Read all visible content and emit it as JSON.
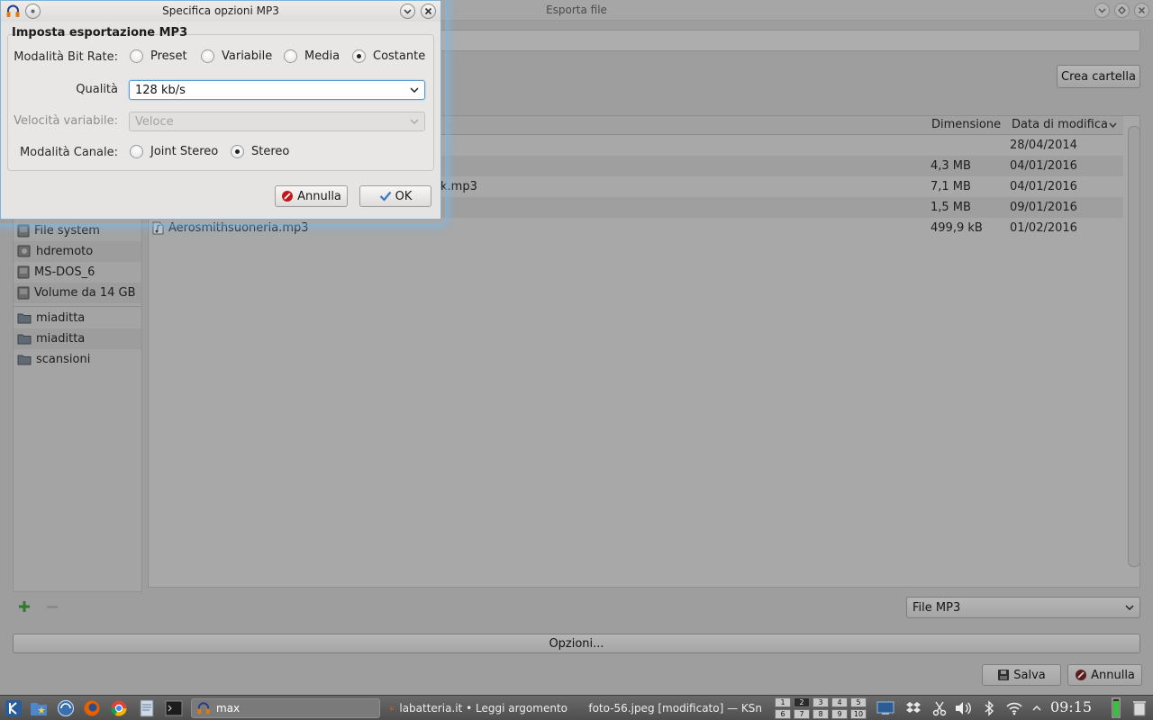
{
  "export_window": {
    "title": "Esporta file",
    "create_folder_label": "Crea cartella",
    "columns": {
      "size": "Dimensione",
      "date": "Data di modifica"
    },
    "places": [
      {
        "label": "File system",
        "icon": "drive-icon"
      },
      {
        "label": "hdremoto",
        "icon": "network-drive-icon"
      },
      {
        "label": "MS-DOS_6",
        "icon": "drive-icon"
      },
      {
        "label": "Volume da 14 GB",
        "icon": "drive-icon"
      },
      {
        "label": "miaditta",
        "icon": "folder-icon"
      },
      {
        "label": "miaditta",
        "icon": "folder-icon"
      },
      {
        "label": "scansioni",
        "icon": "folder-icon"
      }
    ],
    "files": [
      {
        "name": "",
        "size": "",
        "date": "28/04/2014"
      },
      {
        "name": "",
        "size": "4,3 MB",
        "date": "04/01/2016"
      },
      {
        "name": "k.mp3",
        "size": "7,1 MB",
        "date": "04/01/2016"
      },
      {
        "name": "",
        "size": "1,5 MB",
        "date": "09/01/2016"
      },
      {
        "name": "Aerosmithsuoneria.mp3",
        "size": "499,9 kB",
        "date": "01/02/2016"
      }
    ],
    "filter_value": "File MP3",
    "options_label": "Opzioni...",
    "save_label": "Salva",
    "cancel_label": "Annulla"
  },
  "mp3_dialog": {
    "title": "Specifica opzioni MP3",
    "group_title": "Imposta esportazione MP3",
    "bitrate_mode_label": "Modalità Bit Rate:",
    "bitrate_modes": [
      "Preset",
      "Variabile",
      "Media",
      "Costante"
    ],
    "bitrate_mode_selected": "Costante",
    "quality_label": "Qualità",
    "quality_value": "128 kb/s",
    "variable_speed_label": "Velocità variabile:",
    "variable_speed_value": "Veloce",
    "channel_mode_label": "Modalità Canale:",
    "channel_modes": [
      "Joint Stereo",
      "Stereo"
    ],
    "channel_mode_selected": "Stereo",
    "cancel_label": "Annulla",
    "ok_label": "OK"
  },
  "taskbar": {
    "tasks": [
      {
        "label": "max"
      },
      {
        "label": "labatteria.it • Leggi argomento"
      },
      {
        "label": "foto-56.jpeg [modificato] — KSn"
      }
    ],
    "desktops": [
      "1",
      "2",
      "3",
      "4",
      "5",
      "6",
      "7",
      "8",
      "9",
      "10"
    ],
    "active_desktop": "2",
    "clock": "09:15"
  },
  "colors": {
    "dialog_glow": "#78b9eb",
    "focus_border": "#5a9ad0",
    "cancel_icon_red": "#c0161c",
    "ok_icon_blue": "#3a78c0"
  }
}
